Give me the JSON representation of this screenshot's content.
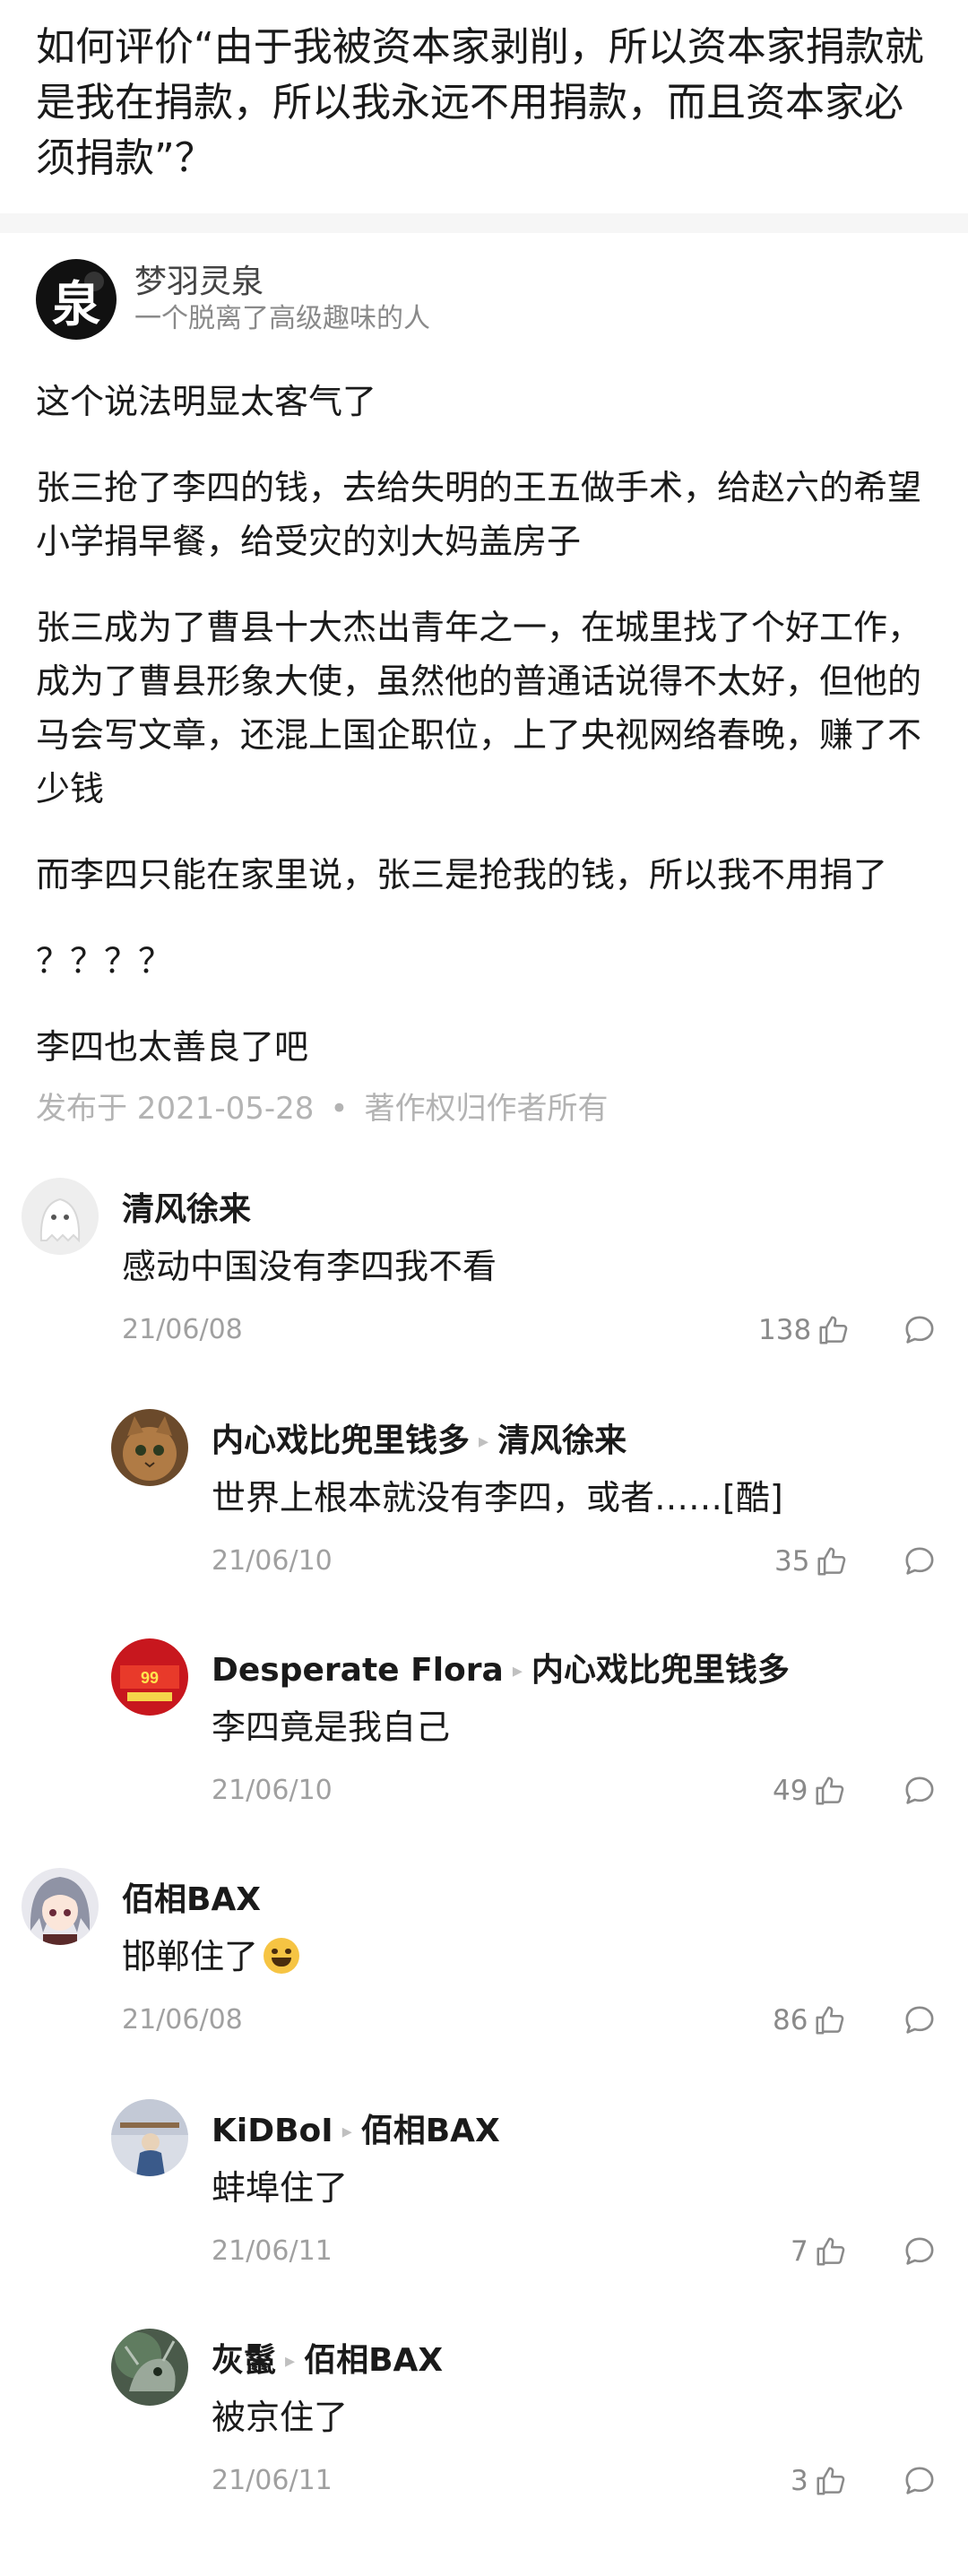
{
  "question": {
    "title": "如何评价“由于我被资本家剥削，所以资本家捐款就是我在捐款，所以我永远不用捐款，而且资本家必须捐款”？"
  },
  "answer": {
    "author_name": "梦羽灵泉",
    "author_bio": "一个脱离了高级趣味的人",
    "avatar_glyph": "泉",
    "paragraphs": [
      "这个说法明显太客气了",
      "张三抢了李四的钱，去给失明的王五做手术，给赵六的希望小学捐早餐，给受灾的刘大妈盖房子",
      "张三成为了曹县十大杰出青年之一，在城里找了个好工作，成为了曹县形象大使，虽然他的普通话说得不太好，但他的马会写文章，还混上国企职位，上了央视网络春晚，赚了不少钱",
      "而李四只能在家里说，张三是抢我的钱，所以我不用捐了",
      "？？？？",
      "李四也太善良了吧"
    ],
    "published": "发布于 2021-05-28",
    "copyright": "著作权归作者所有",
    "dot": "•"
  },
  "comments": [
    {
      "name": "清风徐来",
      "reply_to": "",
      "text": "感动中国没有李四我不看",
      "emoji": "",
      "date": "21/06/08",
      "likes": "138",
      "avatar": "ghost-avatar"
    },
    {
      "name": "内心戏比兜里钱多",
      "reply_to": "清风徐来",
      "text": "世界上根本就没有李四，或者……[酷]",
      "emoji": "",
      "date": "21/06/10",
      "likes": "35",
      "avatar": "cat-avatar"
    },
    {
      "name": "Desperate Flora",
      "reply_to": "内心戏比兜里钱多",
      "text": "李四竟是我自己",
      "emoji": "",
      "date": "21/06/10",
      "likes": "49",
      "avatar": "red-badge-avatar"
    },
    {
      "name": "佰相BAX",
      "reply_to": "",
      "text": "邯郸住了",
      "emoji": "grinning-sweat-emoji",
      "date": "21/06/08",
      "likes": "86",
      "avatar": "anime-avatar"
    },
    {
      "name": "KiDBoI",
      "reply_to": "佰相BAX",
      "text": "蚌埠住了",
      "emoji": "",
      "date": "21/06/11",
      "likes": "7",
      "avatar": "figure-avatar"
    },
    {
      "name": "灰鬣",
      "reply_to": "佰相BAX",
      "text": "被京住了",
      "emoji": "",
      "date": "21/06/11",
      "likes": "3",
      "avatar": "hyena-avatar"
    }
  ],
  "colors": {
    "meta_gray": "#a0a0a0",
    "text": "#1a1a1a",
    "divider": "#f6f6f6"
  },
  "icons": {
    "like": "thumb-up-icon",
    "reply": "comment-bubble-icon",
    "reply_arrow": "triangle-right-icon"
  }
}
